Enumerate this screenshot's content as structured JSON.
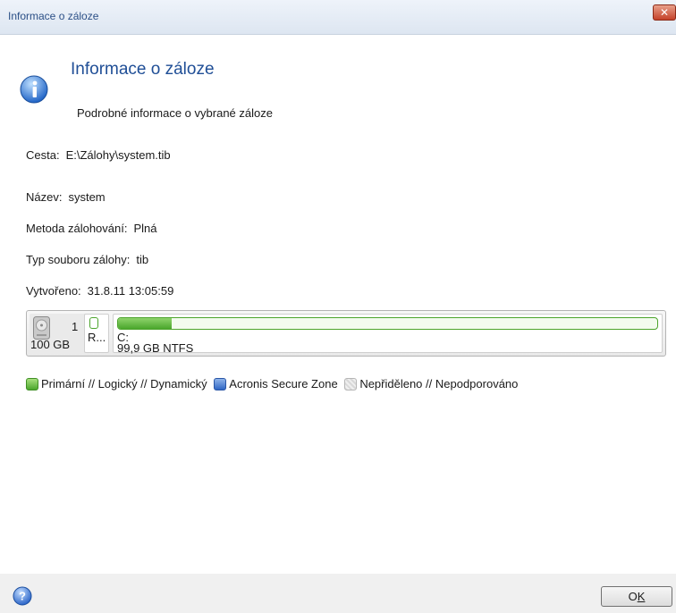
{
  "window": {
    "title": "Informace o záloze",
    "close_label": "✕"
  },
  "header": {
    "heading": "Informace o záloze",
    "subheading": "Podrobné informace o vybrané záloze",
    "icon": "info-icon"
  },
  "fields": {
    "path": {
      "label": "Cesta:",
      "value": "E:\\Zálohy\\system.tib"
    },
    "name": {
      "label": "Název:",
      "value": "system"
    },
    "method": {
      "label": "Metoda zálohování:",
      "value": "Plná"
    },
    "file_type": {
      "label": "Typ souboru zálohy:",
      "value": "tib"
    },
    "created": {
      "label": "Vytvořeno:",
      "value": "31.8.11 13:05:59"
    }
  },
  "disk": {
    "icon": "hdd-icon",
    "number": "1",
    "size": "100 GB",
    "partitions": [
      {
        "label": "R...",
        "used_fraction": 0.0
      },
      {
        "label": "C:",
        "details": "99,9 GB  NTFS",
        "used_fraction": 0.1
      }
    ]
  },
  "legend": [
    {
      "label": "Primární // Logický // Dynamický",
      "color": "#4aa62c"
    },
    {
      "label": "Acronis Secure Zone",
      "color": "#2f66c4"
    },
    {
      "label": "Nepřiděleno // Nepodporováno",
      "color": "#d8d8d8"
    }
  ],
  "footer": {
    "help_icon": "help-icon",
    "ok_prefix": "O",
    "ok_underlined": "K"
  }
}
